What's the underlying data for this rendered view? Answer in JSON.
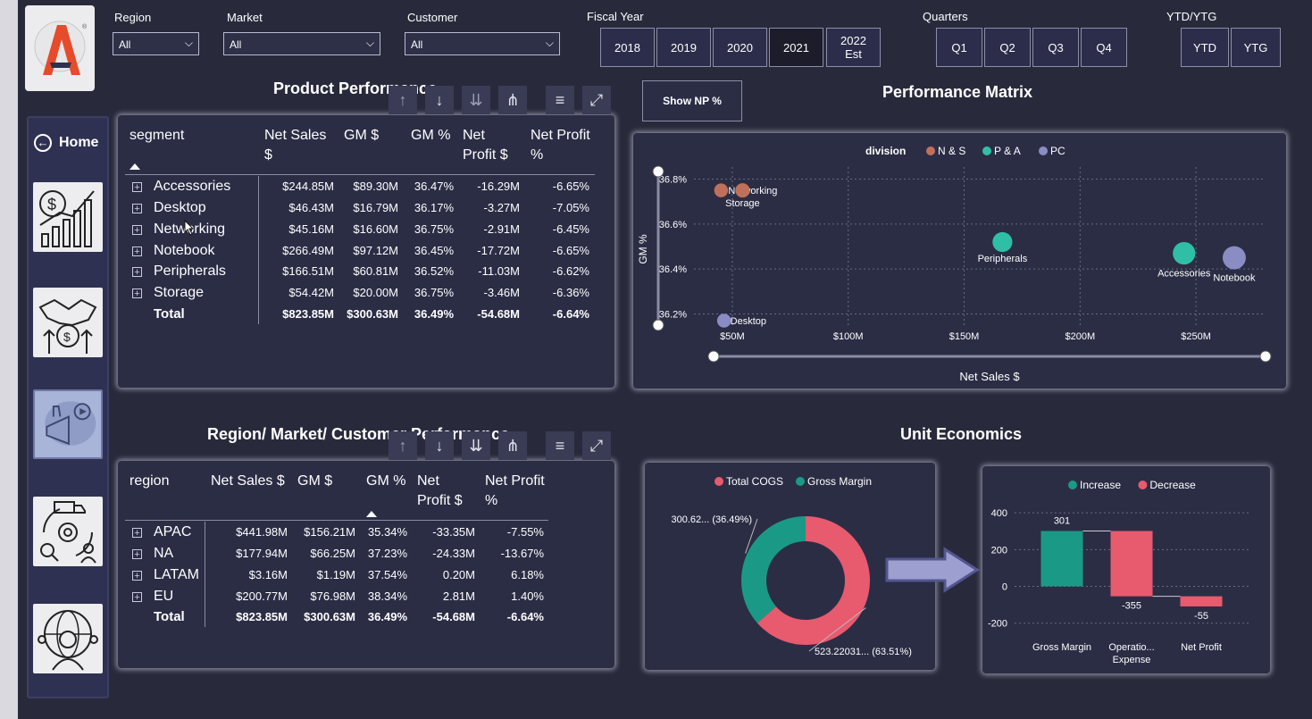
{
  "filters": {
    "region_label": "Region",
    "region_value": "All",
    "market_label": "Market",
    "market_value": "All",
    "customer_label": "Customer",
    "customer_value": "All",
    "fiscal_year_label": "Fiscal Year",
    "years": [
      "2018",
      "2019",
      "2020",
      "2021",
      "2022 Est"
    ],
    "selected_year": "2021",
    "quarters_label": "Quarters",
    "quarters": [
      "Q1",
      "Q2",
      "Q3",
      "Q4"
    ],
    "ytd_label": "YTD/YTG",
    "ytd_options": [
      "YTD",
      "YTG"
    ]
  },
  "nav": {
    "home_label": "Home"
  },
  "product_table": {
    "title": "Product Performance",
    "headers": [
      "segment",
      "Net Sales $",
      "GM $",
      "GM %",
      "Net Profit $",
      "Net Profit %"
    ],
    "rows": [
      {
        "segment": "Accessories",
        "net_sales": "$244.85M",
        "gm": "$89.30M",
        "gm_pct": "36.47%",
        "np": "-16.29M",
        "np_pct": "-6.65%"
      },
      {
        "segment": "Desktop",
        "net_sales": "$46.43M",
        "gm": "$16.79M",
        "gm_pct": "36.17%",
        "np": "-3.27M",
        "np_pct": "-7.05%"
      },
      {
        "segment": "Networking",
        "net_sales": "$45.16M",
        "gm": "$16.60M",
        "gm_pct": "36.75%",
        "np": "-2.91M",
        "np_pct": "-6.45%"
      },
      {
        "segment": "Notebook",
        "net_sales": "$266.49M",
        "gm": "$97.12M",
        "gm_pct": "36.45%",
        "np": "-17.72M",
        "np_pct": "-6.65%"
      },
      {
        "segment": "Peripherals",
        "net_sales": "$166.51M",
        "gm": "$60.81M",
        "gm_pct": "36.52%",
        "np": "-11.03M",
        "np_pct": "-6.62%"
      },
      {
        "segment": "Storage",
        "net_sales": "$54.42M",
        "gm": "$20.00M",
        "gm_pct": "36.75%",
        "np": "-3.46M",
        "np_pct": "-6.36%"
      }
    ],
    "total": {
      "segment": "Total",
      "net_sales": "$823.85M",
      "gm": "$300.63M",
      "gm_pct": "36.49%",
      "np": "-54.68M",
      "np_pct": "-6.64%"
    }
  },
  "region_table": {
    "title": "Region/  Market/ Customer Performance",
    "headers": [
      "region",
      "Net Sales $",
      "GM $",
      "GM %",
      "Net Profit $",
      "Net Profit %"
    ],
    "rows": [
      {
        "region": "APAC",
        "net_sales": "$441.98M",
        "gm": "$156.21M",
        "gm_pct": "35.34%",
        "np": "-33.35M",
        "np_pct": "-7.55%"
      },
      {
        "region": "NA",
        "net_sales": "$177.94M",
        "gm": "$66.25M",
        "gm_pct": "37.23%",
        "np": "-24.33M",
        "np_pct": "-13.67%"
      },
      {
        "region": "LATAM",
        "net_sales": "$3.16M",
        "gm": "$1.19M",
        "gm_pct": "37.54%",
        "np": "0.20M",
        "np_pct": "6.18%"
      },
      {
        "region": "EU",
        "net_sales": "$200.77M",
        "gm": "$76.98M",
        "gm_pct": "38.34%",
        "np": "2.81M",
        "np_pct": "1.40%"
      }
    ],
    "total": {
      "region": "Total",
      "net_sales": "$823.85M",
      "gm": "$300.63M",
      "gm_pct": "36.49%",
      "np": "-54.68M",
      "np_pct": "-6.64%"
    }
  },
  "show_np_button": "Show NP %",
  "perf_matrix_title": "Performance Matrix",
  "unit_econ_title": "Unit Economics",
  "colors": {
    "ns": "#c0705a",
    "pa": "#2fbfa6",
    "pc": "#8a8cc4",
    "cogs": "#e85a6e",
    "gm": "#1a9a86",
    "increase": "#1a9a86",
    "decrease": "#e85a6e"
  },
  "chart_data": [
    {
      "type": "scatter",
      "title": "Performance Matrix",
      "xlabel": "Net Sales $",
      "ylabel": "GM %",
      "legend_title": "division",
      "legend": [
        "N & S",
        "P & A",
        "PC"
      ],
      "xlim": [
        35,
        280
      ],
      "ylim": [
        36.17,
        36.83
      ],
      "x_ticks": [
        "$50M",
        "$100M",
        "$150M",
        "$200M",
        "$250M"
      ],
      "x_tick_values": [
        50,
        100,
        150,
        200,
        250
      ],
      "y_ticks": [
        "36.8%",
        "36.6%",
        "36.4%",
        "36.2%"
      ],
      "y_tick_values": [
        36.8,
        36.6,
        36.4,
        36.2
      ],
      "points": [
        {
          "label": "Networking",
          "division": "N & S",
          "x": 45.16,
          "y": 36.75
        },
        {
          "label": "Storage",
          "division": "N & S",
          "x": 54.42,
          "y": 36.75
        },
        {
          "label": "Desktop",
          "division": "PC",
          "x": 46.43,
          "y": 36.17
        },
        {
          "label": "Peripherals",
          "division": "P & A",
          "x": 166.51,
          "y": 36.52
        },
        {
          "label": "Accessories",
          "division": "P & A",
          "x": 244.85,
          "y": 36.47
        },
        {
          "label": "Notebook",
          "division": "PC",
          "x": 266.49,
          "y": 36.45
        }
      ]
    },
    {
      "type": "pie",
      "legend": [
        "Total COGS",
        "Gross Margin"
      ],
      "slices": [
        {
          "name": "Total COGS",
          "value": 523.22031,
          "label": "523.22031... (63.51%)"
        },
        {
          "name": "Gross Margin",
          "value": 300.62,
          "label": "300.62... (36.49%)"
        }
      ]
    },
    {
      "type": "bar",
      "subtype": "waterfall",
      "legend": [
        "Increase",
        "Decrease"
      ],
      "categories": [
        "Gross Margin",
        "Operatio... Expense",
        "Net Profit"
      ],
      "values": [
        301,
        -355,
        -55
      ],
      "labels": [
        "301",
        "-355",
        "-55"
      ],
      "y_ticks": [
        "400",
        "200",
        "0",
        "-200"
      ],
      "y_tick_values": [
        400,
        200,
        0,
        -200
      ],
      "ylim": [
        -250,
        420
      ]
    }
  ]
}
